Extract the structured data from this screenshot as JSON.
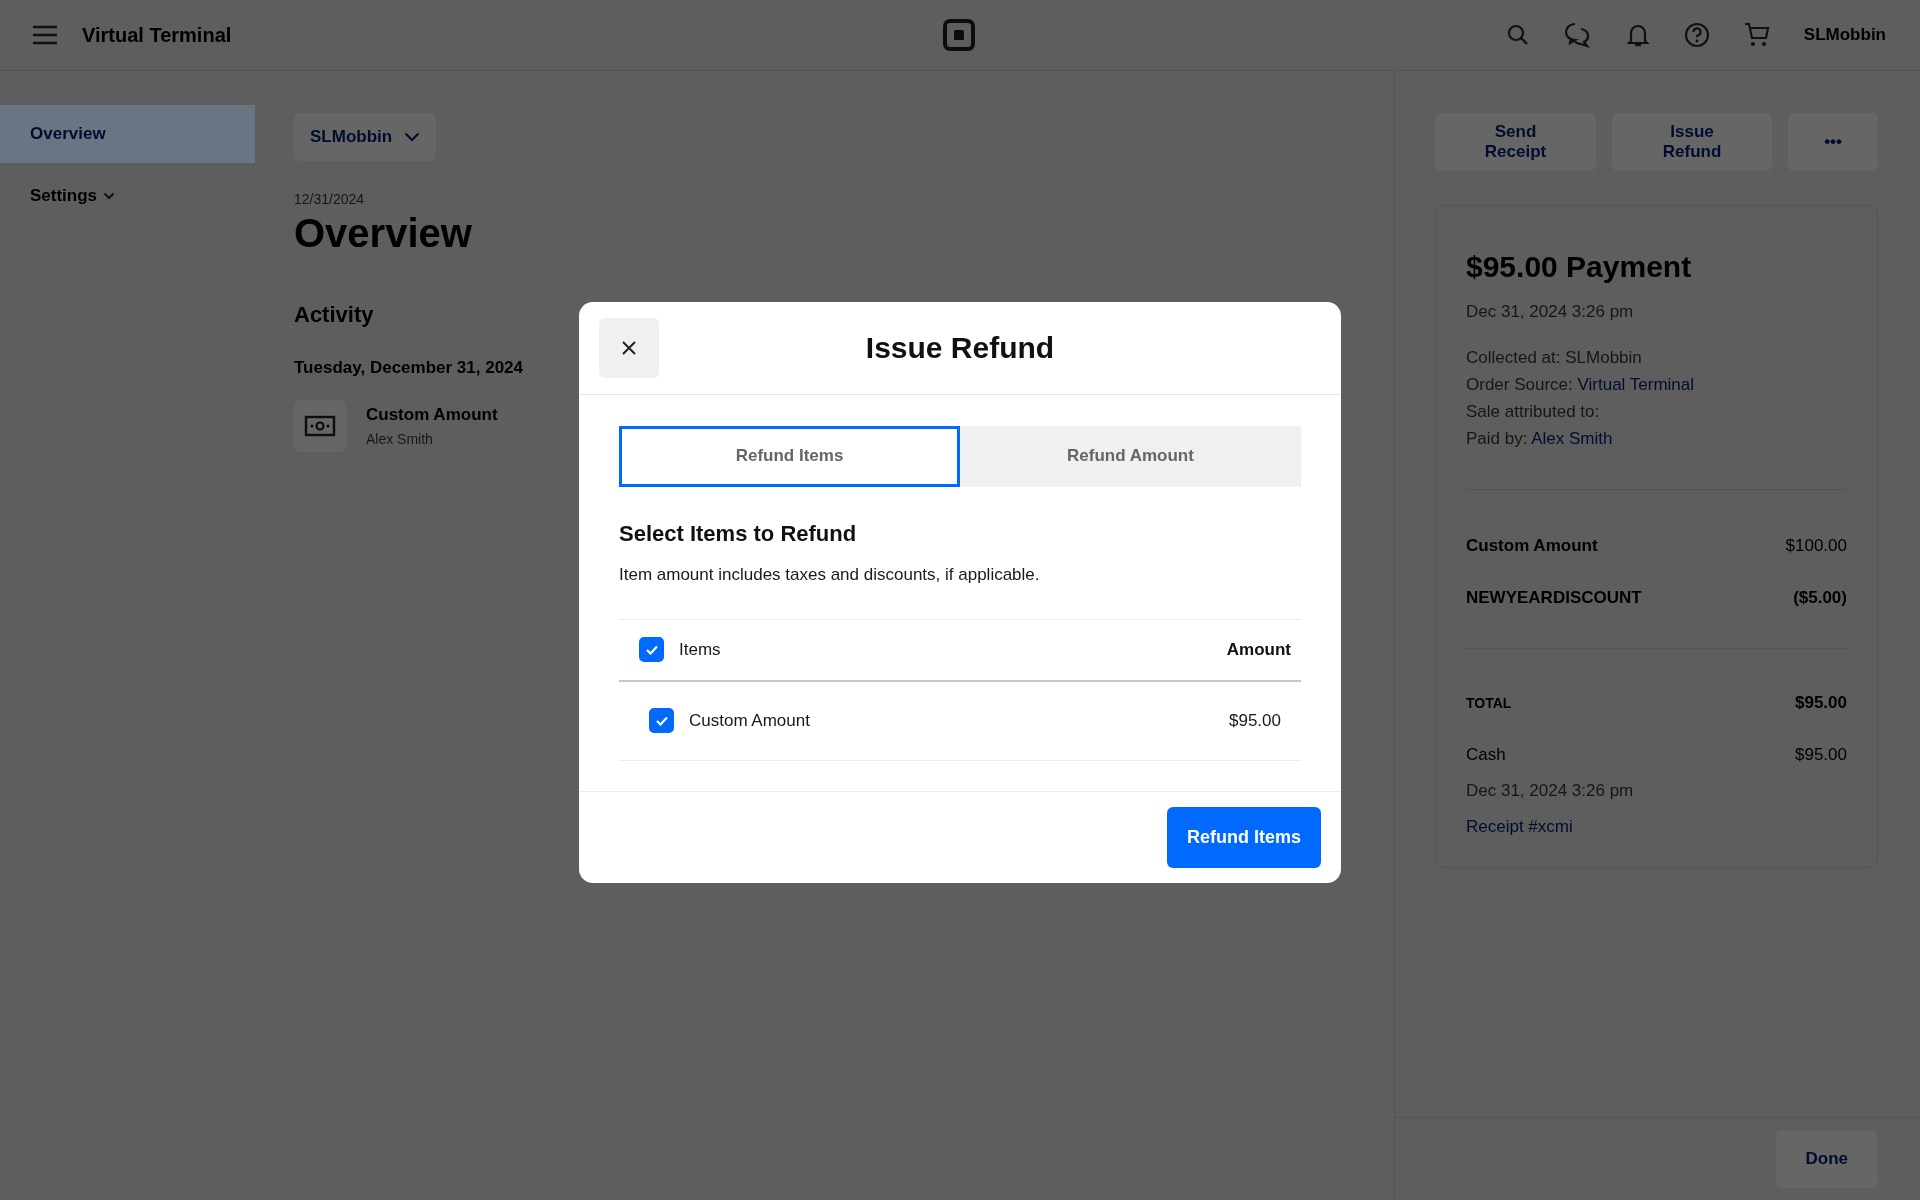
{
  "topbar": {
    "title": "Virtual Terminal",
    "user": "SLMobbin"
  },
  "sidebar": {
    "items": [
      {
        "label": "Overview",
        "selected": true,
        "kind": "link"
      },
      {
        "label": "Settings",
        "selected": false,
        "kind": "group",
        "expanded": false
      }
    ]
  },
  "main": {
    "location_button": "SLMobbin",
    "date": "12/31/2024",
    "heading": "Overview",
    "section": "Activity",
    "day": "Tuesday, December 31, 2024",
    "activity": [
      {
        "title": "Custom Amount",
        "subtitle": "Alex Smith"
      }
    ]
  },
  "payment_panel": {
    "actions": [
      "Send Receipt",
      "Issue Refund"
    ],
    "more": "•••",
    "title": "$95.00 Payment",
    "timestamp": "Dec 31, 2024 3:26 pm",
    "details": [
      {
        "label": "Collected at: SLMobbin"
      },
      {
        "label": "Order Source: ",
        "link": "Virtual Terminal"
      },
      {
        "label": "Sale attributed to:"
      },
      {
        "label": "Paid by: ",
        "link": "Alex Smith"
      }
    ],
    "line_items": [
      {
        "name": "Custom Amount",
        "amount": "$100.00",
        "kind": "item"
      },
      {
        "name": "NEWYEARDISCOUNT",
        "amount": "($5.00)",
        "kind": "discount"
      }
    ],
    "total": {
      "label": "TOTAL",
      "amount": "$95.00"
    },
    "tender": {
      "method": "Cash",
      "amount": "$95.00",
      "timestamp": "Dec 31, 2024 3:26 pm",
      "receipt": "Receipt #xcmi"
    },
    "done": "Done"
  },
  "modal": {
    "title": "Issue Refund",
    "tabs": [
      {
        "label": "Refund Items",
        "selected": true
      },
      {
        "label": "Refund Amount",
        "selected": false
      }
    ],
    "heading": "Select Items to Refund",
    "note": "Item amount includes taxes and discounts, if applicable.",
    "table": {
      "header": {
        "checked": true,
        "label": "Items",
        "amount": "Amount"
      },
      "rows": [
        {
          "checked": true,
          "name": "Custom Amount",
          "amount": "$95.00"
        }
      ]
    },
    "primary_button": "Refund Items"
  }
}
